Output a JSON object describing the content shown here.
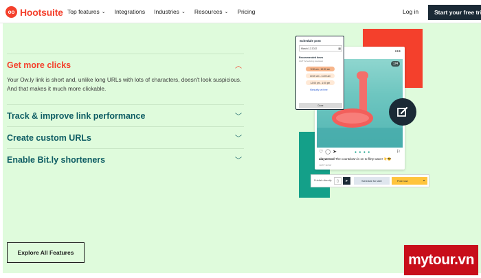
{
  "nav": {
    "logo": "Hootsuite",
    "logo_mark": "oo",
    "items": [
      {
        "label": "Top features",
        "dropdown": true
      },
      {
        "label": "Integrations",
        "dropdown": false
      },
      {
        "label": "Industries",
        "dropdown": true
      },
      {
        "label": "Resources",
        "dropdown": true
      },
      {
        "label": "Pricing",
        "dropdown": false
      }
    ],
    "login": "Log in",
    "trial": "Start your free trial"
  },
  "accordion": {
    "items": [
      {
        "title": "Get more clicks",
        "expanded": true
      },
      {
        "title": "Track & improve link performance",
        "expanded": false
      },
      {
        "title": "Create custom URLs",
        "expanded": false
      },
      {
        "title": "Enable Bit.ly shorteners",
        "expanded": false
      }
    ],
    "active_body": "Your Ow.ly link is short and, unlike long URLs with lots of characters, doesn't look suspicious. And that makes it much more clickable."
  },
  "explore_button": "Explore All Features",
  "schedule": {
    "title": "Schedule post",
    "date": "March 12 2022",
    "recommended": "Recommended times",
    "recommended_sub": "GMT Scheduling Assistant",
    "times": [
      "9:30 am - 10:30 am",
      "10:00 am - 11:00 am",
      "12:00 pm - 1:00 pm"
    ],
    "manual": "Manually set time",
    "done": "Done"
  },
  "post": {
    "badge": "1/4",
    "user": "alayatrnod",
    "caption": "The countdown is on to flirty wave! ☀️😎",
    "time": "JUST NOW"
  },
  "publish": {
    "label": "Publish directly",
    "later": "Schedule for later",
    "now": "Post now"
  },
  "watermark": "mytour.vn",
  "colors": {
    "brand": "#f4402c",
    "teal_text": "#0d5c63",
    "background": "#dffbdc",
    "dark": "#1b2a36",
    "accent_green": "#14a089",
    "yellow": "#ffc43d"
  }
}
